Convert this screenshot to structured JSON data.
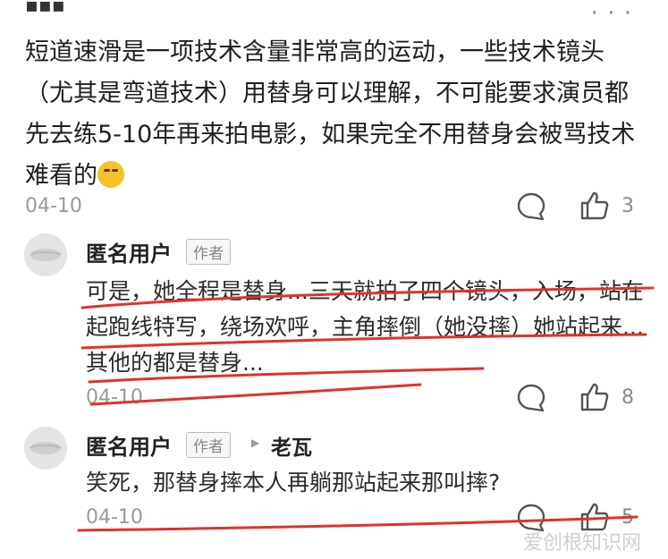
{
  "top_cut_text": "•••",
  "main": {
    "text": "短道速滑是一项技术含量非常高的运动，一些技术镜头（尤其是弯道技术）用替身可以理解，不可能要求演员都先去练5-10年再来拍电影，如果完全不用替身会被骂技术难看的",
    "date": "04-10",
    "likes": "3"
  },
  "replies": [
    {
      "user": "匿名用户",
      "tag": "作者",
      "text": "可是，她全程是替身...三天就拍了四个镜头，入场，站在起跑线特写，绕场欢呼，主角摔倒（她没摔）她站起来...其他的都是替身...",
      "date": "04-10",
      "likes": "8"
    },
    {
      "user": "匿名用户",
      "tag": "作者",
      "reply_to": "老瓦",
      "text": "笑死，那替身摔本人再躺那站起来那叫摔?",
      "date": "04-10",
      "likes": "5"
    }
  ],
  "watermark": "爱创根知识网",
  "colors": {
    "underline": "#e0322e",
    "muted": "#9a9a9a"
  },
  "icons": [
    "more-icon",
    "comment-icon",
    "like-icon",
    "avatar-icon",
    "reply-arrow-icon",
    "emoji-icon"
  ]
}
